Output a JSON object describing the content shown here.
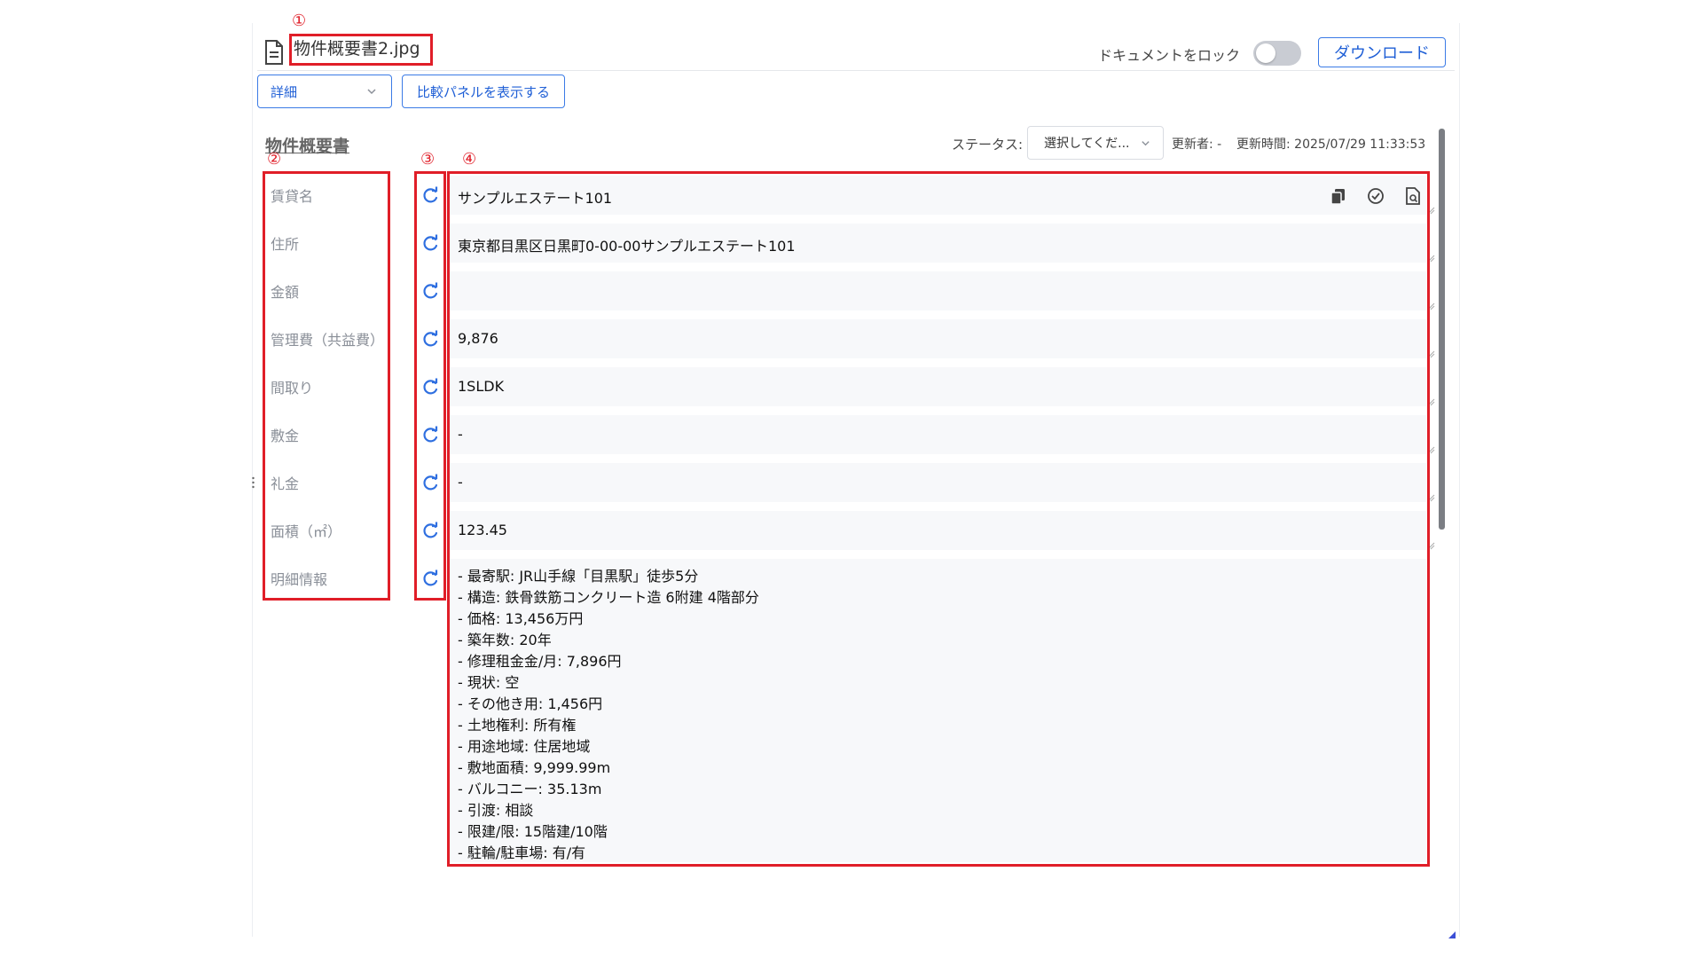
{
  "header": {
    "file_name": "物件概要書2.jpg",
    "lock_label": "ドキュメントをロック",
    "lock_enabled": false,
    "download_label": "ダウンロード"
  },
  "toolbar": {
    "view_select": "詳細",
    "compare_button": "比較パネルを表示する"
  },
  "section": {
    "title": "物件概要書",
    "status_label": "ステータス:",
    "status_select": "選択してくだ...",
    "updater": "更新者: -",
    "updated_time": "更新時間: 2025/07/29 11:33:53"
  },
  "fields": [
    {
      "label": "賃貸名",
      "value": "サンプルエステート101"
    },
    {
      "label": "住所",
      "value": "東京都目黒区日黒町0-00-00サンプルエステート101"
    },
    {
      "label": "金額",
      "value": ""
    },
    {
      "label": "管理費（共益費）",
      "value": "9,876"
    },
    {
      "label": "間取り",
      "value": "1SLDK"
    },
    {
      "label": "敷金",
      "value": "-"
    },
    {
      "label": "礼金",
      "value": "-"
    },
    {
      "label": "面積（㎡）",
      "value": "123.45"
    },
    {
      "label": "明細情報",
      "value": "- 最寄駅: JR山手線「目黒駅」徒歩5分\n- 構造: 鉄骨鉄筋コンクリート造 6附建 4階部分\n- 価格: 13,456万円\n- 築年数: 20年\n- 修理租金金/月: 7,896円\n- 現状: 空\n- その他き用: 1,456円\n- 土地権利: 所有権\n- 用途地域: 住居地域\n- 敷地面積: 9,999.99m\n- バルコニー: 35.13m\n- 引渡: 相談\n- 限建/限: 15階建/10階\n- 駐輪/駐車場: 有/有"
    }
  ],
  "annotations": [
    "①",
    "②",
    "③",
    "④"
  ],
  "colors": {
    "accent": "#3b7be6",
    "annotation": "#e01e28",
    "label": "#8a8f98"
  },
  "icons": [
    "file-icon",
    "chevron-down-icon",
    "refresh-icon",
    "copy-icon",
    "check-circle-icon",
    "document-search-icon"
  ]
}
